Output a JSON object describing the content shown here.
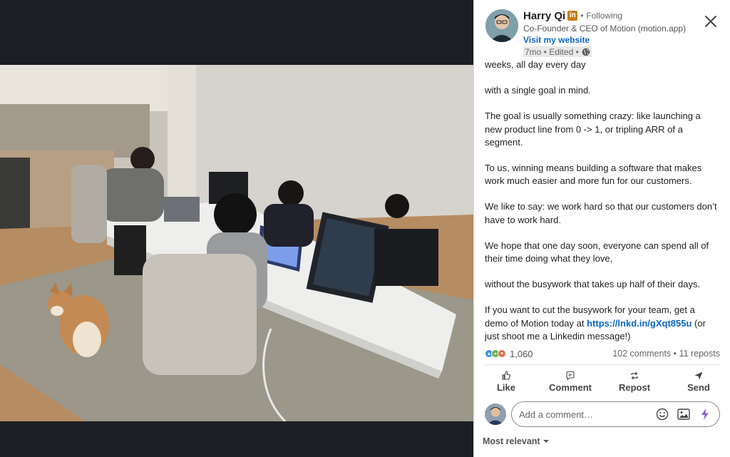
{
  "author": {
    "name": "Harry Qi",
    "in_badge": "in",
    "separator": "•",
    "follow_status": "Following",
    "headline": "Co-Founder & CEO of Motion (motion.app)",
    "website_label": "Visit my website",
    "meta": "7mo • Edited •"
  },
  "post": {
    "paragraphs": [
      "weeks, all day every day",
      "with a single goal in mind.",
      "The goal is usually something crazy: like launching a new product line from 0 -> 1, or tripling ARR of a segment.",
      "To us, winning means building a software that makes work much easier and more fun for our customers.",
      "We like to say: we work hard so that our customers don’t have to work hard.",
      "We hope that one day soon, everyone can spend all of their time doing what they love,",
      "without the busywork that takes up half of their days."
    ],
    "last_before": "If you want to cut the busywork for your team, get a demo of Motion today at ",
    "link": "https://lnkd.in/gXqt855u",
    "last_after": " (or just shoot me a Linkedin message!)"
  },
  "stats": {
    "reactions": "1,060",
    "comments": "102 comments",
    "separator": "•",
    "reposts": "11 reposts"
  },
  "actions": {
    "like": "Like",
    "comment": "Comment",
    "repost": "Repost",
    "send": "Send"
  },
  "comment_box": {
    "placeholder": "Add a comment…"
  },
  "sort": {
    "label": "Most relevant"
  },
  "colors": {
    "link": "#0a66c2",
    "badge": "#c37d16",
    "viewer_bg": "#1b1f23"
  },
  "icons": [
    "close-icon",
    "globe-icon",
    "like-icon",
    "comment-icon",
    "repost-icon",
    "send-icon",
    "emoji-icon",
    "image-icon",
    "spark-icon",
    "caret-down-icon"
  ]
}
